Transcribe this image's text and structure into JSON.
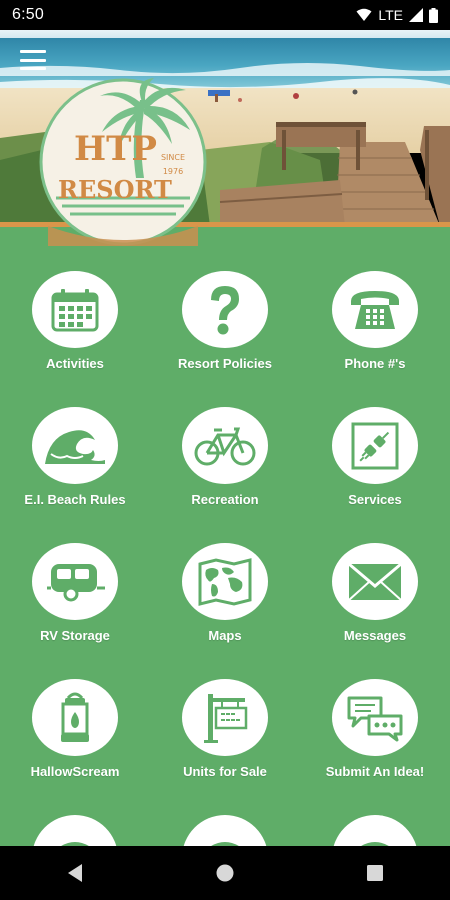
{
  "status_bar": {
    "time": "6:50",
    "network": "LTE"
  },
  "header": {
    "menu_icon": "hamburger-menu-icon",
    "logo": {
      "line1": "HTP",
      "line2": "RESORT",
      "since_1": "SINCE",
      "since_2": "1976"
    }
  },
  "tiles": [
    {
      "label": "Activities",
      "icon": "calendar-icon"
    },
    {
      "label": "Resort Policies",
      "icon": "question-mark-icon"
    },
    {
      "label": "Phone #'s",
      "icon": "telephone-icon"
    },
    {
      "label": "E.I. Beach Rules",
      "icon": "wave-icon"
    },
    {
      "label": "Recreation",
      "icon": "bicycle-icon"
    },
    {
      "label": "Services",
      "icon": "plug-icon"
    },
    {
      "label": "RV Storage",
      "icon": "camper-trailer-icon"
    },
    {
      "label": "Maps",
      "icon": "world-map-icon"
    },
    {
      "label": "Messages",
      "icon": "envelope-icon"
    },
    {
      "label": "HallowScream",
      "icon": "lantern-icon"
    },
    {
      "label": "Units for Sale",
      "icon": "for-sale-sign-icon"
    },
    {
      "label": "Submit An Idea!",
      "icon": "chat-bubbles-icon"
    }
  ],
  "colors": {
    "main_green": "#5fad68",
    "accent_orange": "#d9964a",
    "logo_green": "#7cc08a"
  }
}
